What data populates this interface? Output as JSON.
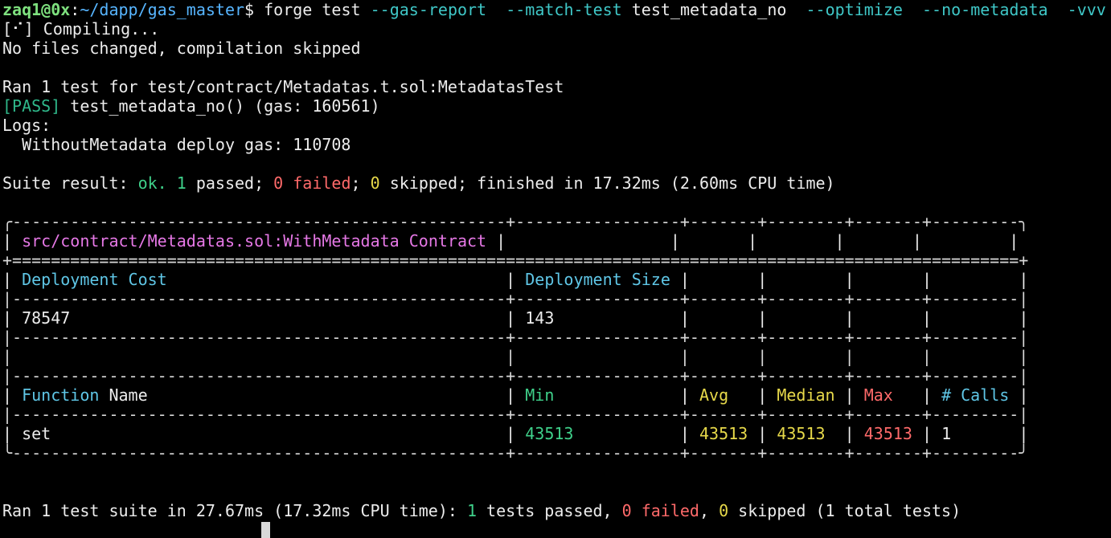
{
  "prompt": {
    "user": "zaq1@0x",
    "path": "~/dapp/gas_master",
    "symbol": "$",
    "command": "forge test",
    "flags": [
      "--gas-report",
      "--match-test",
      "test_metadata_no",
      "--optimize",
      "--no-metadata",
      "-vvv"
    ]
  },
  "output": {
    "compiling": "[⠊] Compiling...",
    "no_files": "No files changed, compilation skipped",
    "ran_line": "Ran 1 test for test/contract/Metadatas.t.sol:MetadatasTest",
    "pass_tag": "[PASS]",
    "pass_rest": " test_metadata_no() (gas: 160561)",
    "logs_label": "Logs:",
    "log_entry": "  WithoutMetadata deploy gas: 110708",
    "suite": {
      "prefix": "Suite result: ",
      "ok": "ok.",
      "passed_count": "1",
      "passed_text": " passed; ",
      "failed_count": "0",
      "failed_text": " failed",
      "sep": "; ",
      "skipped_count": "0",
      "skipped_text": " skipped; finished in 17.32ms (2.60ms CPU time)"
    }
  },
  "table": {
    "title": "src/contract/Metadatas.sol:WithMetadata Contract",
    "deploy_cost_label": "Deployment Cost",
    "deploy_size_label": "Deployment Size",
    "deploy_cost": "78547",
    "deploy_size": "143",
    "headers": {
      "function": "Function",
      "name": " Name",
      "min": "Min",
      "avg": "Avg",
      "median": "Median",
      "max": "Max",
      "calls": "# Calls"
    },
    "rows": [
      {
        "fn": "set",
        "min": "43513",
        "avg": "43513",
        "median": "43513",
        "max": "43513",
        "calls": "1"
      }
    ]
  },
  "summary": {
    "prefix": "Ran 1 test suite in 27.67ms (17.32ms CPU time): ",
    "passed_count": "1",
    "passed_text": " tests passed, ",
    "failed_count": "0",
    "failed_text": " failed",
    "sep": ", ",
    "skipped_count": "0",
    "skipped_text": " skipped (1 total tests)"
  },
  "colors": {
    "background": "#000000",
    "foreground": "#ececec",
    "user": "#7ee07e",
    "path": "#57b5ff",
    "flag": "#3fc7c7",
    "pass": "#2fb88a",
    "ok": "#3fd08a",
    "failed": "#ff6a6a",
    "skipped": "#e7d94a",
    "contract": "#e678e6",
    "header": "#5fc6e6"
  }
}
